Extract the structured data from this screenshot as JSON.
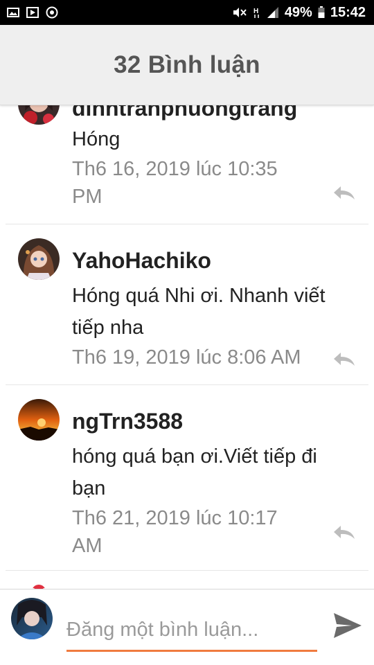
{
  "status_bar": {
    "battery": "49%",
    "time": "15:42"
  },
  "header": {
    "title": "32 Bình luận"
  },
  "comments": [
    {
      "author": "dinhtranphuongtrang",
      "text": "Hóng",
      "date": "Th6 16, 2019 lúc 10:35 PM"
    },
    {
      "author": "YahoHachiko",
      "text": "Hóng quá Nhi ơi. Nhanh viết tiếp nha",
      "date": "Th6 19, 2019 lúc 8:06 AM"
    },
    {
      "author": "ngTrn3588",
      "text": "hóng quá bạn ơi.Viết tiếp đi bạn",
      "date": "Th6 21, 2019 lúc 10:17 AM"
    }
  ],
  "compose": {
    "placeholder": "Đăng một bình luận..."
  },
  "colors": {
    "accent": "#f07b3f",
    "header_bg": "#efefef"
  }
}
